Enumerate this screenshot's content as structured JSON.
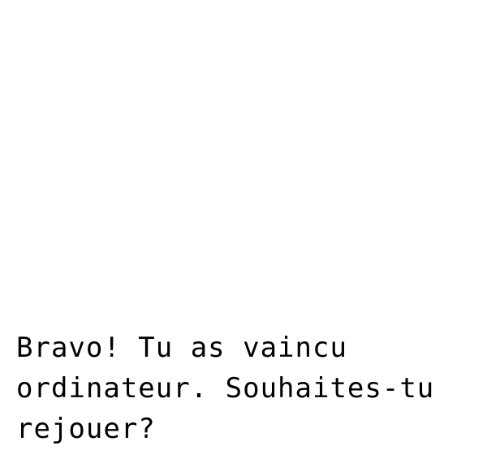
{
  "dialog": {
    "lines": [
      "Bravo! Tu as vaincu",
      "ordinateur. Souhaites-tu",
      "rejouer?"
    ]
  },
  "colors": {
    "background": "#ffffff",
    "text": "#000000"
  }
}
